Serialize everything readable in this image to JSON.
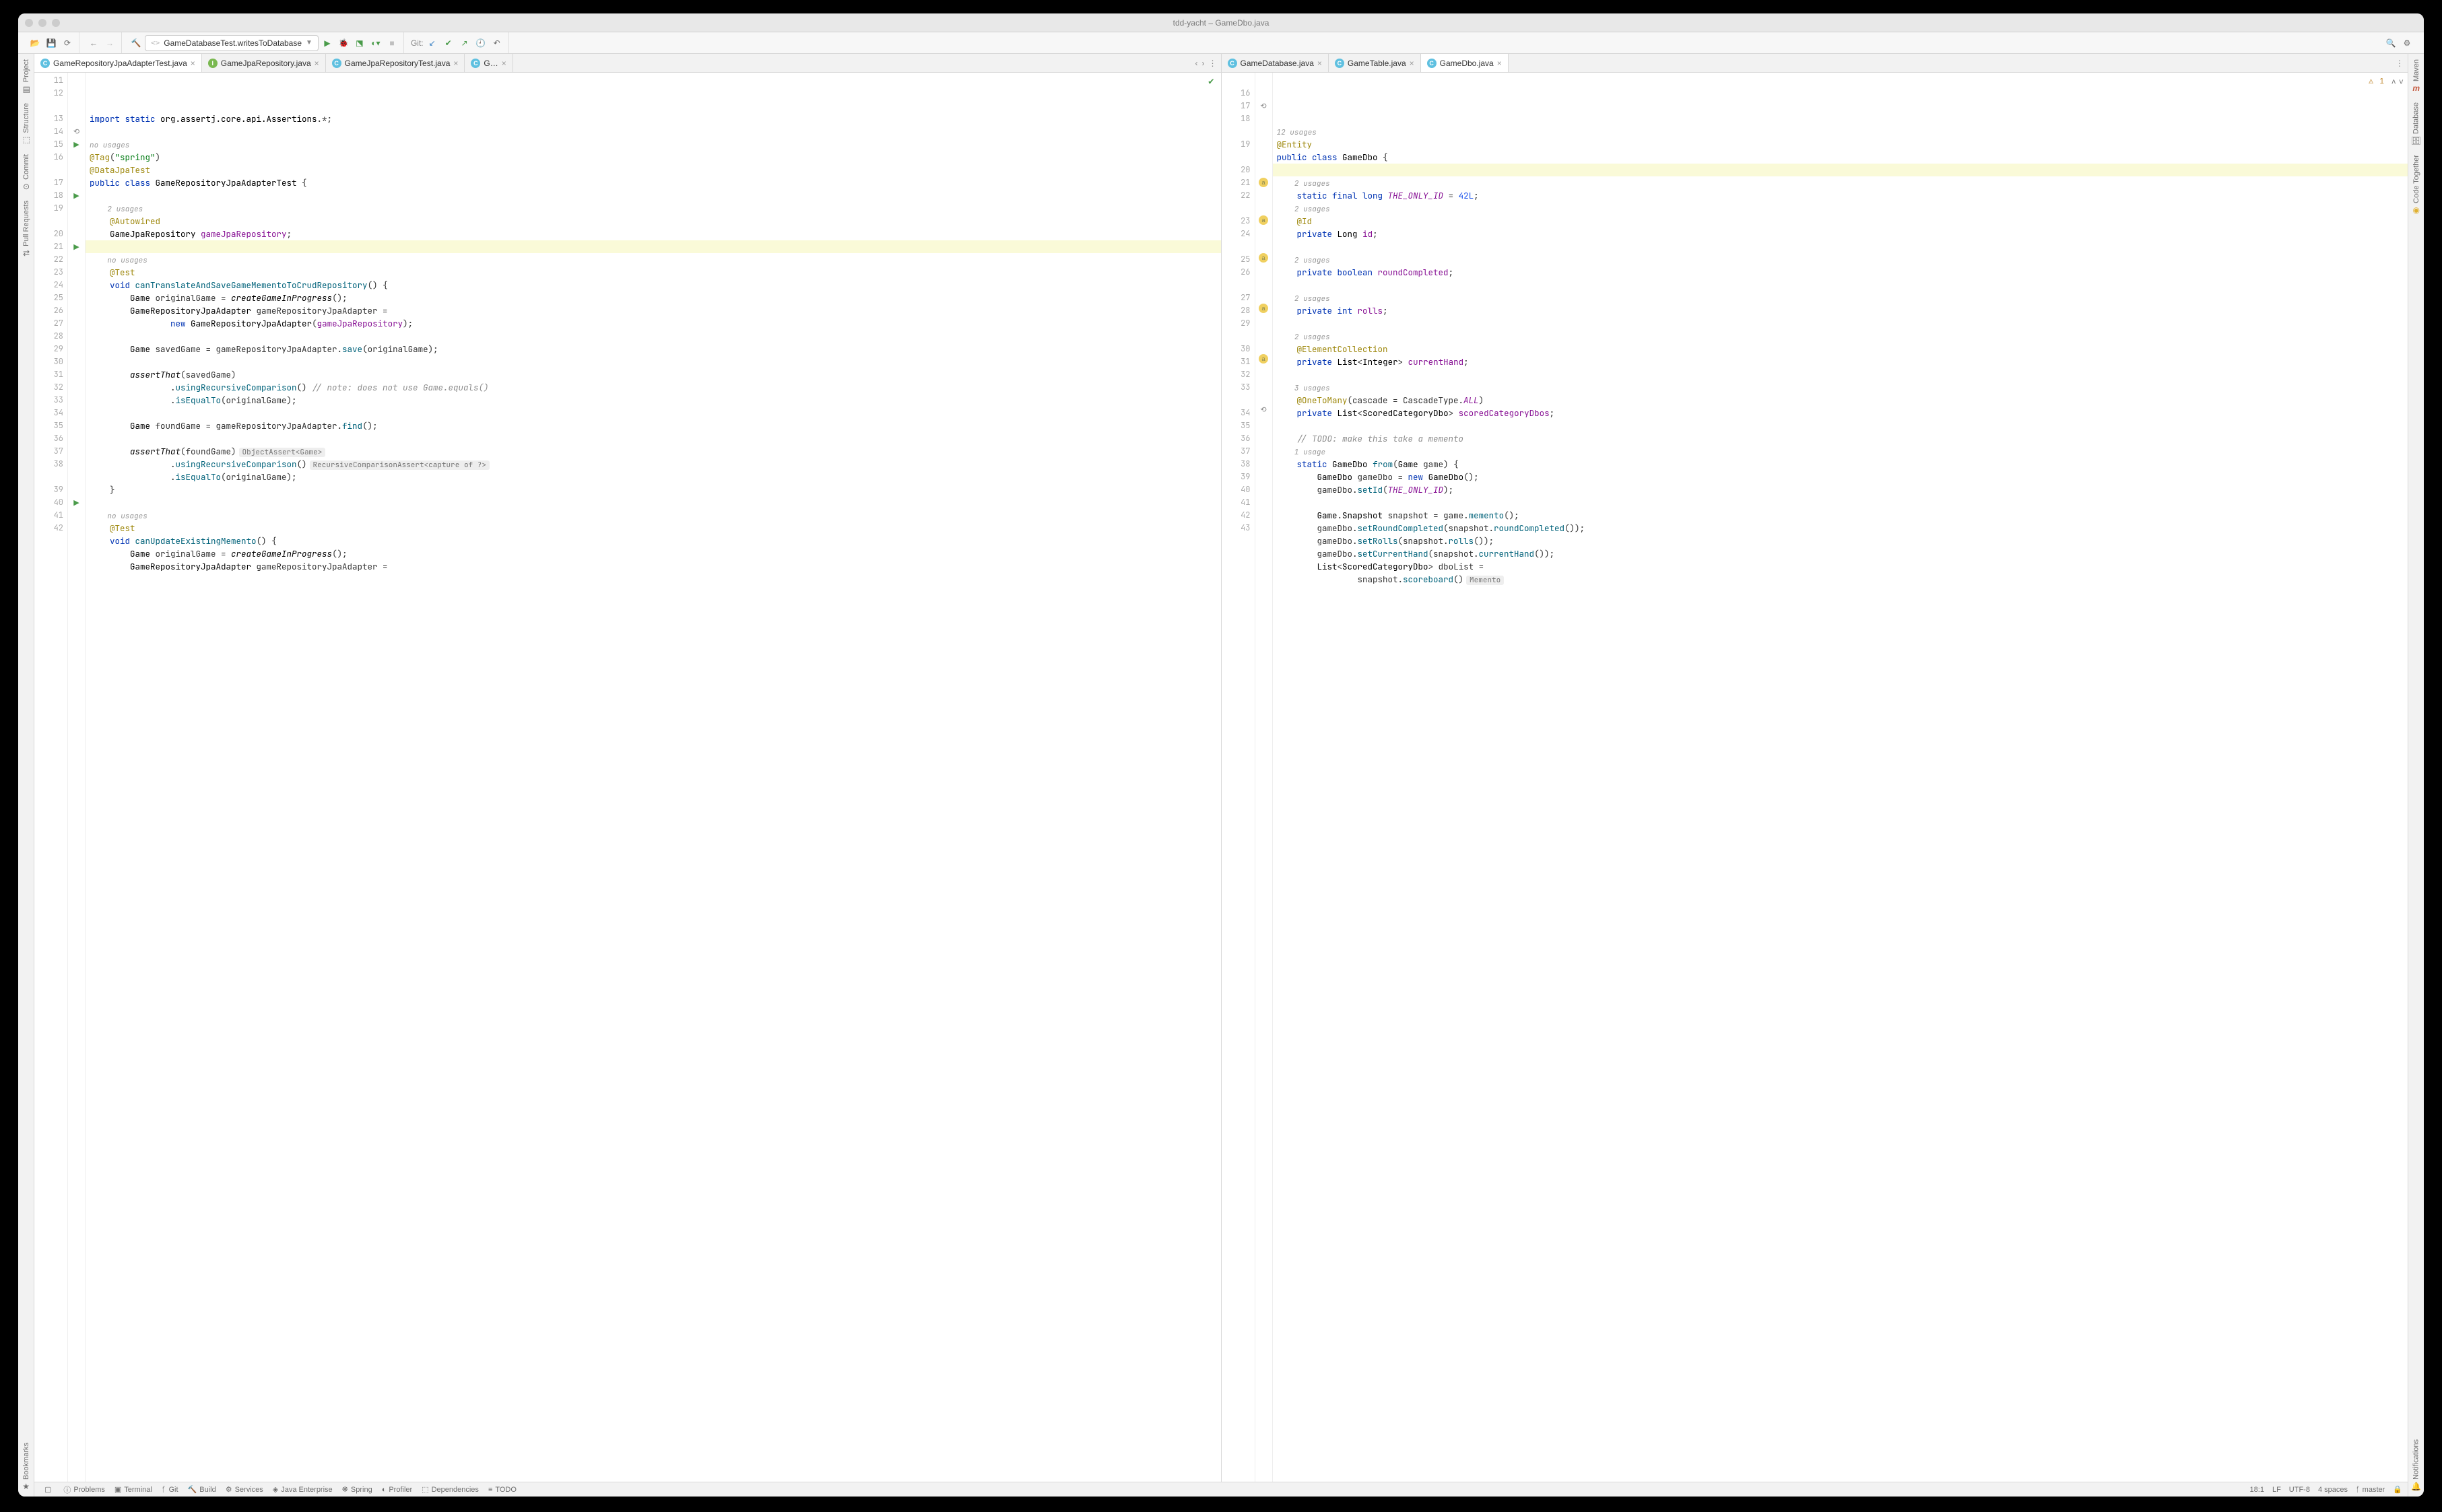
{
  "window": {
    "title": "tdd-yacht – GameDbo.java"
  },
  "toolbar": {
    "runconf_prefix": "<>",
    "runconf_name": "GameDatabaseTest.writesToDatabase",
    "git_label": "Git:"
  },
  "sidebar_left": {
    "items": [
      "Project",
      "Structure",
      "Commit",
      "Pull Requests"
    ],
    "bottom": "Bookmarks"
  },
  "sidebar_right": {
    "items": [
      "Maven",
      "Database",
      "Code Together"
    ],
    "bottom": "Notifications"
  },
  "tabs_left": [
    {
      "label": "GameRepositoryJpaAdapterTest.java",
      "active": true,
      "icon": "C"
    },
    {
      "label": "GameJpaRepository.java",
      "active": false,
      "icon": "I"
    },
    {
      "label": "GameJpaRepositoryTest.java",
      "active": false,
      "icon": "C"
    },
    {
      "label": "G…",
      "active": false,
      "icon": "C"
    }
  ],
  "tabs_right": [
    {
      "label": "GameDatabase.java",
      "active": false,
      "icon": "C"
    },
    {
      "label": "GameTable.java",
      "active": false,
      "icon": "C"
    },
    {
      "label": "GameDbo.java",
      "active": true,
      "icon": "C"
    }
  ],
  "left_editor": {
    "first_line_no": 11,
    "warning_count": null,
    "lines": [
      {
        "n": 11,
        "html": "<span class='kw'>import static</span> <span class='clsname'>org.assertj.core.api.Assertions</span>.*;"
      },
      {
        "n": 12,
        "html": ""
      },
      {
        "n": null,
        "usage": "no usages"
      },
      {
        "n": 13,
        "html": "<span class='ann'>@Tag</span>(<span class='str'>\"spring\"</span>)"
      },
      {
        "n": 14,
        "html": "<span class='ann'>@DataJpaTest</span>",
        "gut": "over"
      },
      {
        "n": 15,
        "html": "<span class='kw'>public class</span> <span class='clsname'>GameRepositoryJpaAdapterTest</span> {",
        "gut": "run"
      },
      {
        "n": 16,
        "html": ""
      },
      {
        "n": null,
        "usage": "    2 usages"
      },
      {
        "n": 17,
        "html": "    <span class='ann'>@Autowired</span>"
      },
      {
        "n": 18,
        "html": "    <span class='clsname'>GameJpaRepository</span> <span class='fld'>gameJpaRepository</span>;",
        "gut": "run"
      },
      {
        "n": 19,
        "html": "",
        "hl": true
      },
      {
        "n": null,
        "usage": "    no usages"
      },
      {
        "n": 20,
        "html": "    <span class='ann'>@Test</span>"
      },
      {
        "n": 21,
        "html": "    <span class='kw'>void</span> <span class='mth'>canTranslateAndSaveGameMementoToCrudRepository</span>() {",
        "gut": "run"
      },
      {
        "n": 22,
        "html": "        <span class='clsname'>Game</span> originalGame = <span class='stmth'>createGameInProgress</span>();"
      },
      {
        "n": 23,
        "html": "        <span class='clsname'>GameRepositoryJpaAdapter</span> gameRepositoryJpaAdapter ="
      },
      {
        "n": 24,
        "html": "                <span class='kw'>new</span> <span class='clsname'>GameRepositoryJpaAdapter</span>(<span class='fld'>gameJpaRepository</span>);"
      },
      {
        "n": 25,
        "html": ""
      },
      {
        "n": 26,
        "html": "        <span class='clsname'>Game</span> savedGame = gameRepositoryJpaAdapter.<span class='mth'>save</span>(originalGame);"
      },
      {
        "n": 27,
        "html": ""
      },
      {
        "n": 28,
        "html": "        <span class='stmth'>assertThat</span>(savedGame)"
      },
      {
        "n": 29,
        "html": "                .<span class='mth'>usingRecursiveComparison</span>() <span class='cmt'>// note: does not use Game.equals()</span>"
      },
      {
        "n": 30,
        "html": "                .<span class='mth'>isEqualTo</span>(originalGame);"
      },
      {
        "n": 31,
        "html": ""
      },
      {
        "n": 32,
        "html": "        <span class='clsname'>Game</span> foundGame = gameRepositoryJpaAdapter.<span class='mth'>find</span>();"
      },
      {
        "n": 33,
        "html": ""
      },
      {
        "n": 34,
        "html": "        <span class='stmth'>assertThat</span>(foundGame)<span class='inlay'>ObjectAssert&lt;Game&gt;</span>"
      },
      {
        "n": 35,
        "html": "                .<span class='mth'>usingRecursiveComparison</span>()<span class='inlay'>RecursiveComparisonAssert&lt;capture of ?&gt;</span>"
      },
      {
        "n": 36,
        "html": "                .<span class='mth'>isEqualTo</span>(originalGame);"
      },
      {
        "n": 37,
        "html": "    }"
      },
      {
        "n": 38,
        "html": ""
      },
      {
        "n": null,
        "usage": "    no usages"
      },
      {
        "n": 39,
        "html": "    <span class='ann'>@Test</span>"
      },
      {
        "n": 40,
        "html": "    <span class='kw'>void</span> <span class='mth'>canUpdateExistingMemento</span>() {",
        "gut": "run"
      },
      {
        "n": 41,
        "html": "        <span class='clsname'>Game</span> originalGame = <span class='stmth'>createGameInProgress</span>();"
      },
      {
        "n": 42,
        "html": "        <span class='clsname'>GameRepositoryJpaAdapter</span> gameRepositoryJpaAdapter ="
      }
    ]
  },
  "right_editor": {
    "warning_count": "1",
    "lines": [
      {
        "n": null,
        "usage": "12 usages"
      },
      {
        "n": 16,
        "html": "<span class='ann'>@Entity</span>"
      },
      {
        "n": 17,
        "html": "<span class='kw'>public class</span> <span class='clsname'>GameDbo</span> {",
        "gut": "over"
      },
      {
        "n": 18,
        "html": "",
        "hl": true
      },
      {
        "n": null,
        "usage": "    2 usages"
      },
      {
        "n": 19,
        "html": "    <span class='kw'>static final long</span> <span class='const'>THE_ONLY_ID</span> = <span class='num'>42L</span>;"
      },
      {
        "n": null,
        "usage": "    2 usages"
      },
      {
        "n": 20,
        "html": "    <span class='ann'>@Id</span>"
      },
      {
        "n": 21,
        "html": "    <span class='kw'>private</span> <span class='clsname'>Long</span> <span class='fld'>id</span>;",
        "gut": "badge"
      },
      {
        "n": 22,
        "html": ""
      },
      {
        "n": null,
        "usage": "    2 usages"
      },
      {
        "n": 23,
        "html": "    <span class='kw'>private boolean</span> <span class='fld'>roundCompleted</span>;",
        "gut": "badge"
      },
      {
        "n": 24,
        "html": ""
      },
      {
        "n": null,
        "usage": "    2 usages"
      },
      {
        "n": 25,
        "html": "    <span class='kw'>private int</span> <span class='fld'>rolls</span>;",
        "gut": "badge"
      },
      {
        "n": 26,
        "html": ""
      },
      {
        "n": null,
        "usage": "    2 usages"
      },
      {
        "n": 27,
        "html": "    <span class='ann'>@ElementCollection</span>"
      },
      {
        "n": 28,
        "html": "    <span class='kw'>private</span> <span class='clsname'>List</span>&lt;<span class='clsname'>Integer</span>&gt; <span class='fld'>currentHand</span>;",
        "gut": "badge"
      },
      {
        "n": 29,
        "html": ""
      },
      {
        "n": null,
        "usage": "    3 usages"
      },
      {
        "n": 30,
        "html": "    <span class='ann'>@OneToMany</span>(cascade = CascadeType.<span class='const'>ALL</span>)"
      },
      {
        "n": 31,
        "html": "    <span class='kw'>private</span> <span class='clsname'>List</span>&lt;<span class='clsname'>ScoredCategoryDbo</span>&gt; <span class='fld'>scoredCategoryDbos</span>;",
        "gut": "badge"
      },
      {
        "n": 32,
        "html": ""
      },
      {
        "n": 33,
        "html": "    <span class='cmt'>// TODO: make this take a memento</span>"
      },
      {
        "n": null,
        "usage": "    1 usage"
      },
      {
        "n": 34,
        "html": "    <span class='kw'>static</span> <span class='clsname'>GameDbo</span> <span class='mth'>from</span>(<span class='clsname'>Game</span> game) {",
        "gut": "over"
      },
      {
        "n": 35,
        "html": "        <span class='clsname'>GameDbo</span> gameDbo = <span class='kw'>new</span> <span class='clsname'>GameDbo</span>();"
      },
      {
        "n": 36,
        "html": "        gameDbo.<span class='mth'>setId</span>(<span class='const'>THE_ONLY_ID</span>);"
      },
      {
        "n": 37,
        "html": ""
      },
      {
        "n": 38,
        "html": "        <span class='clsname'>Game</span>.<span class='clsname'>Snapshot</span> snapshot = game.<span class='mth'>memento</span>();"
      },
      {
        "n": 39,
        "html": "        gameDbo.<span class='mth'>setRoundCompleted</span>(snapshot.<span class='mth'>roundCompleted</span>());"
      },
      {
        "n": 40,
        "html": "        gameDbo.<span class='mth'>setRolls</span>(snapshot.<span class='mth'>rolls</span>());"
      },
      {
        "n": 41,
        "html": "        gameDbo.<span class='mth'>setCurrentHand</span>(snapshot.<span class='mth'>currentHand</span>());"
      },
      {
        "n": 42,
        "html": "        <span class='clsname'>List</span>&lt;<span class='clsname'>ScoredCategoryDbo</span>&gt; dboList ="
      },
      {
        "n": 43,
        "html": "                snapshot.<span class='mth'>scoreboard</span>()<span class='inlay'>Memento</span>"
      }
    ]
  },
  "statusbar": {
    "left": [
      {
        "icon": "ⓘ",
        "label": "Problems"
      },
      {
        "icon": "▣",
        "label": "Terminal"
      },
      {
        "icon": "ᚶ",
        "label": "Git"
      },
      {
        "icon": "🔨",
        "label": "Build"
      },
      {
        "icon": "⚙",
        "label": "Services"
      },
      {
        "icon": "◈",
        "label": "Java Enterprise"
      },
      {
        "icon": "❋",
        "label": "Spring"
      },
      {
        "icon": "◐",
        "label": "Profiler"
      },
      {
        "icon": "⬚",
        "label": "Dependencies"
      },
      {
        "icon": "≡",
        "label": "TODO"
      }
    ],
    "right": {
      "pos": "18:1",
      "sep": "LF",
      "enc": "UTF-8",
      "indent": "4 spaces",
      "branch_icon": "ᚶ",
      "branch": "master"
    }
  }
}
